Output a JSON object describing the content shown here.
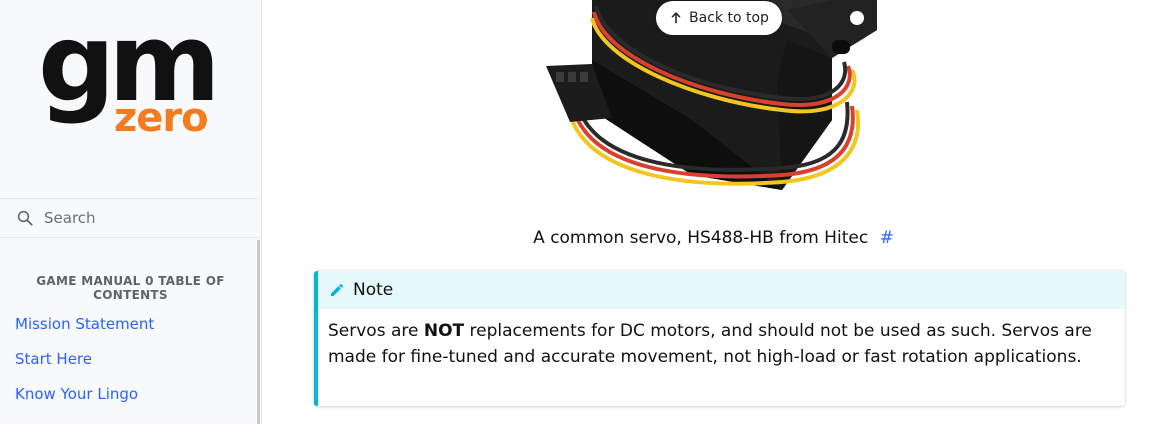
{
  "sidebar": {
    "logo": {
      "main": "gm",
      "sub": "zero"
    },
    "search": {
      "placeholder": "Search",
      "icon": "search-icon"
    },
    "toc_title": "GAME MANUAL 0 TABLE OF CONTENTS",
    "items": [
      {
        "label": "Mission Statement"
      },
      {
        "label": "Start Here"
      },
      {
        "label": "Know Your Lingo"
      }
    ]
  },
  "main": {
    "back_to_top": "Back to top",
    "caption": "A common servo, HS488-HB from Hitec",
    "caption_anchor": "#",
    "note": {
      "title": "Note",
      "body_before": "Servos are ",
      "body_bold": "NOT",
      "body_after": " replacements for DC motors, and should not be used as such. Servos are made for fine-tuned and accurate movement, not high-load or fast rotation applications."
    }
  },
  "colors": {
    "accent_link": "#2962ff",
    "logo_orange": "#f47c20",
    "note_border": "#00b8d4",
    "note_title_bg": "#e5f8fb"
  }
}
